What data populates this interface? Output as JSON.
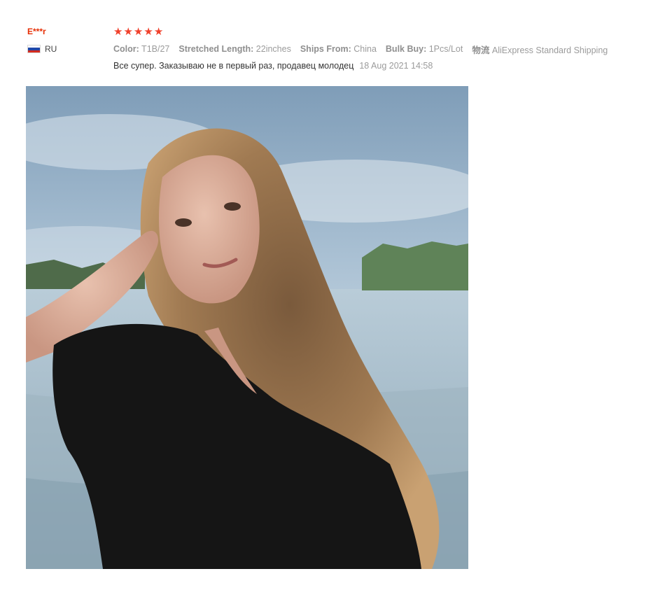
{
  "review": {
    "user_name": "E***r",
    "country_code": "RU",
    "flag_colors": [
      "#ffffff",
      "#1f47a8",
      "#d52b1e"
    ],
    "rating": 5,
    "star_color": "#f0412c",
    "attributes": [
      {
        "label": "Color:",
        "value": "T1B/27"
      },
      {
        "label": "Stretched Length:",
        "value": "22inches"
      },
      {
        "label": "Ships From:",
        "value": "China"
      },
      {
        "label": "Bulk Buy:",
        "value": "1Pcs/Lot"
      },
      {
        "label": "物流",
        "value": "AliExpress Standard Shipping"
      }
    ],
    "text": "Все супер. Заказываю не в первый раз, продавец молодец",
    "date": "18 Aug 2021 14:58",
    "photo_icon": "review-photo"
  }
}
